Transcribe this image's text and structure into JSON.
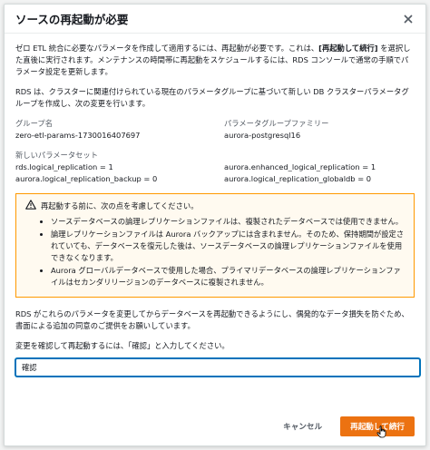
{
  "modal": {
    "title": "ソースの再起動が必要",
    "intro_1": "ゼロ ETL 統合に必要なパラメータを作成して適用するには、再起動が必要です。これは、",
    "intro_bold": "[再起動して続行]",
    "intro_2": " を選択した直後に実行されます。メンテナンスの時間帯に再起動をスケジュールするには、RDS コンソールで通常の手順でパラメータ設定を更新します。",
    "rds_para": "RDS は、クラスターに関連付けられている現在のパラメータグループに基づいて新しい DB クラスターパラメータグループを作成し、次の変更を行います。",
    "group_name_label": "グループ名",
    "group_name_value": "zero-etl-params-1730016407697",
    "family_label": "パラメータグループファミリー",
    "family_value": "aurora-postgresql16",
    "new_params_label": "新しいパラメータセット",
    "params_left": [
      "rds.logical_replication = 1",
      "aurora.logical_replication_backup = 0"
    ],
    "params_right": [
      "aurora.enhanced_logical_replication = 1",
      "aurora.logical_replication_globaldb = 0"
    ],
    "warning": {
      "heading": "再起動する前に、次の点を考慮してください。",
      "items": [
        "ソースデータベースの論理レプリケーションファイルは、複製されたデータベースでは使用できません。",
        "論理レプリケーションファイルは Aurora バックアップには含まれません。そのため、保持期間が設定されていても、データベースを復元した後は、ソースデータベースの論理レプリケーションファイルを使用できなくなります。",
        "Aurora グローバルデータベースで使用した場合、プライマリデータベースの論理レプリケーションファイルはセカンダリリージョンのデータベースに複製されません。"
      ]
    },
    "consent_para": "RDS がこれらのパラメータを変更してからデータベースを再起動できるようにし、偶発的なデータ損失を防ぐため、書面による追加の同意のご提供をお願いしています。",
    "confirm_label": "変更を確認して再起動するには、「確認」と入力してください。",
    "confirm_value": "確認",
    "cancel_label": "キャンセル",
    "primary_label": "再起動して続行"
  },
  "colors": {
    "accent_orange": "#ec7211",
    "warning_border": "#ff9900",
    "input_focus": "#0073bb"
  }
}
